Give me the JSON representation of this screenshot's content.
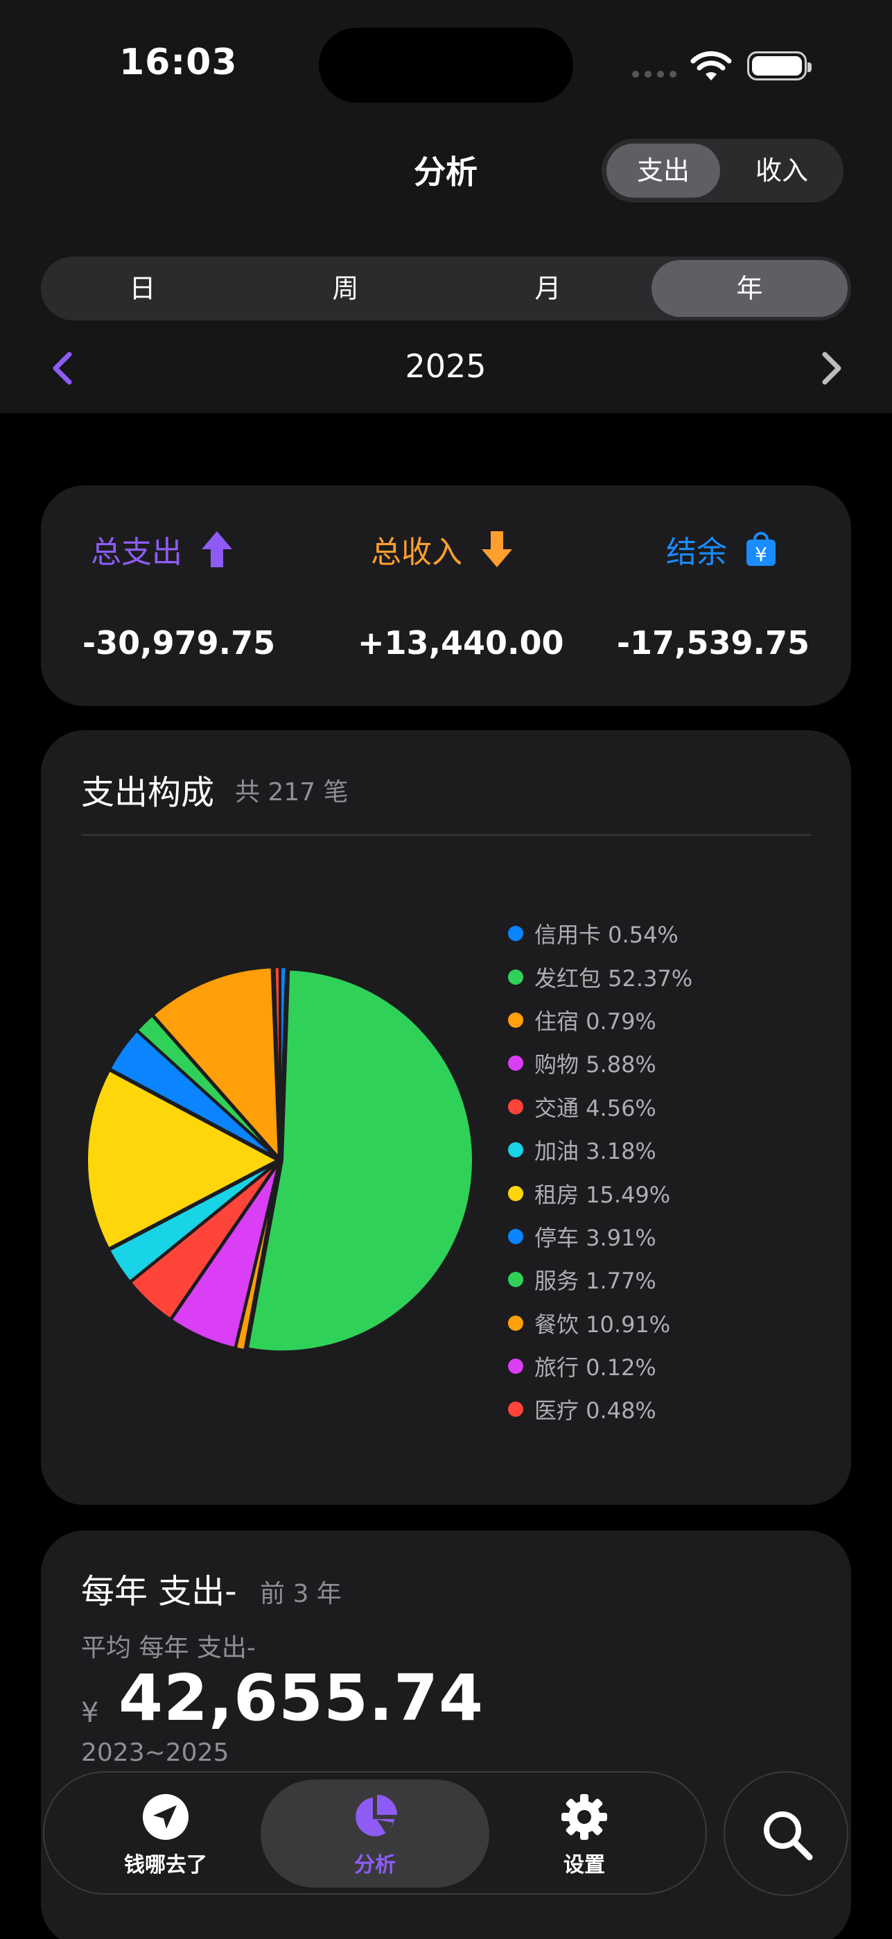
{
  "status": {
    "time": "16:03"
  },
  "nav": {
    "title": "分析",
    "type_options": [
      "支出",
      "收入"
    ],
    "type_selected": 0
  },
  "period": {
    "options": [
      "日",
      "周",
      "月",
      "年"
    ],
    "selected": 3
  },
  "year": "2025",
  "summary": {
    "expense_label": "总支出",
    "income_label": "总收入",
    "balance_label": "结余",
    "expense_value": "-30,979.75",
    "income_value": "+13,440.00",
    "balance_value": "-17,539.75",
    "colors": {
      "expense": "#8e5cf5",
      "income": "#ff9f2e",
      "balance": "#1a8cff"
    }
  },
  "composition": {
    "title": "支出构成",
    "count_text": "共 217 笔"
  },
  "chart_data": {
    "type": "pie",
    "slices": [
      {
        "label": "信用卡 0.54%",
        "value": 0.54,
        "color": "#0a84ff"
      },
      {
        "label": "发红包 52.37%",
        "value": 52.37,
        "color": "#30d158"
      },
      {
        "label": "住宿 0.79%",
        "value": 0.79,
        "color": "#ff9f0a"
      },
      {
        "label": "购物 5.88%",
        "value": 5.88,
        "color": "#da3ef5"
      },
      {
        "label": "交通 4.56%",
        "value": 4.56,
        "color": "#ff453a"
      },
      {
        "label": "加油 3.18%",
        "value": 3.18,
        "color": "#19d3e6"
      },
      {
        "label": "租房 15.49%",
        "value": 15.49,
        "color": "#ffd60a"
      },
      {
        "label": "停车 3.91%",
        "value": 3.91,
        "color": "#0a84ff"
      },
      {
        "label": "服务 1.77%",
        "value": 1.77,
        "color": "#30d158"
      },
      {
        "label": "餐饮 10.91%",
        "value": 10.91,
        "color": "#ff9f0a"
      },
      {
        "label": "旅行 0.12%",
        "value": 0.12,
        "color": "#da3ef5"
      },
      {
        "label": "医疗 0.48%",
        "value": 0.48,
        "color": "#ff453a"
      }
    ]
  },
  "yearly": {
    "title": "每年 支出-",
    "subtitle": "前 3 年",
    "avg_label": "平均 每年 支出-",
    "currency": "¥",
    "avg_value": "42,655.74",
    "range": "2023~2025"
  },
  "tabbar": {
    "tabs": [
      {
        "label": "钱哪去了",
        "icon": "location-arrow-icon"
      },
      {
        "label": "分析",
        "icon": "pie-chart-icon"
      },
      {
        "label": "设置",
        "icon": "gear-icon"
      }
    ],
    "active": 1,
    "search_icon": "search-icon"
  }
}
